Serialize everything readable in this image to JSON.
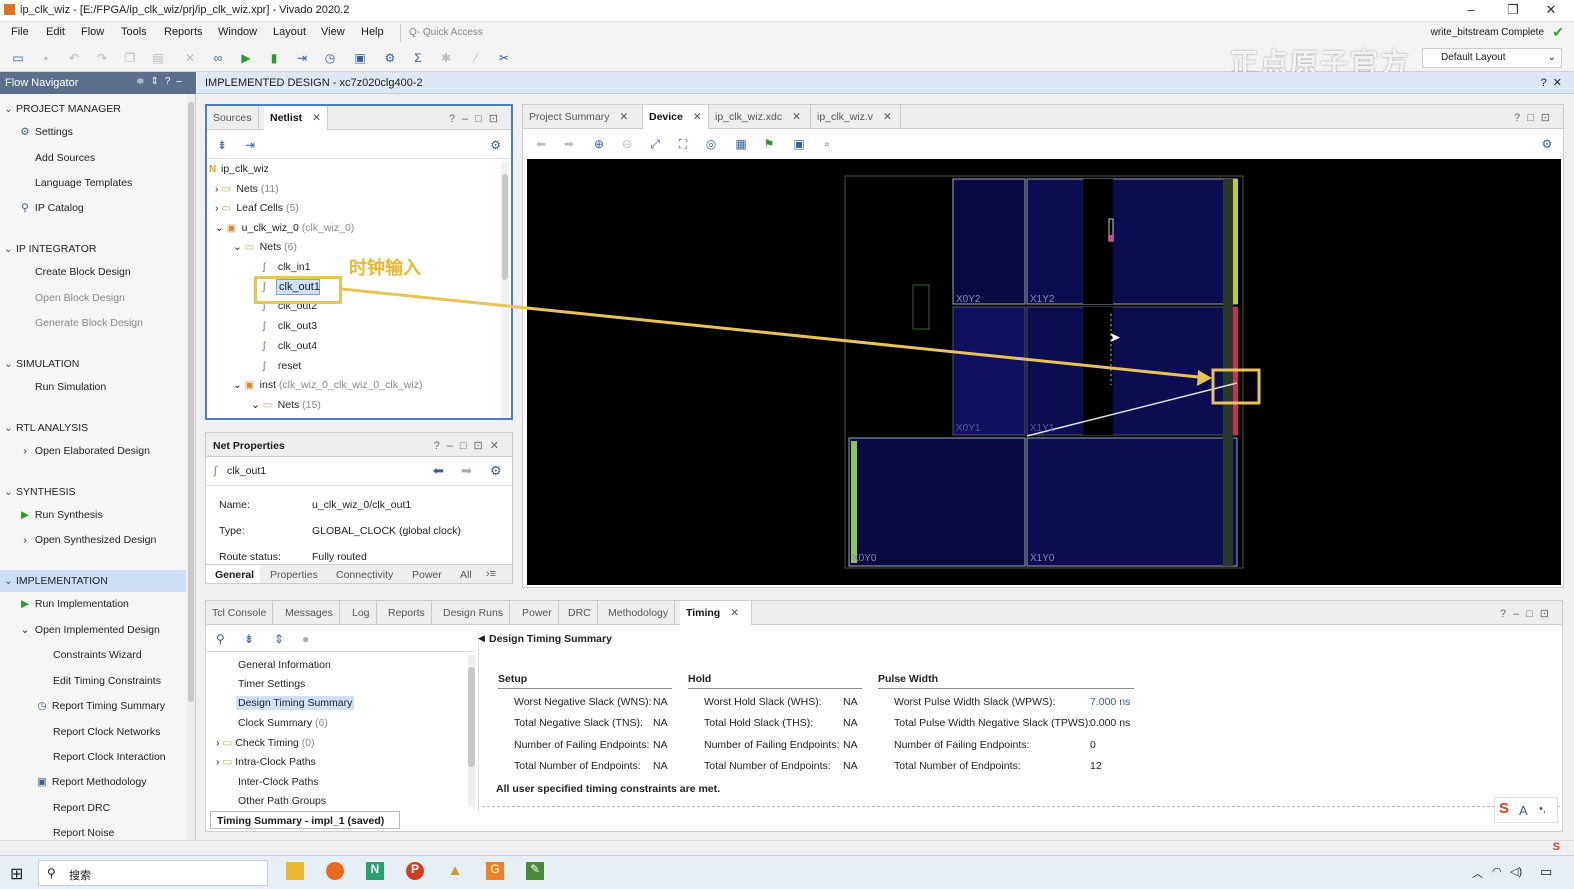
{
  "window": {
    "title": "ip_clk_wiz - [E:/FPGA/ip_clk_wiz/prj/ip_clk_wiz.xpr] - Vivado 2020.2"
  },
  "menu": [
    "File",
    "Edit",
    "Flow",
    "Tools",
    "Reports",
    "Window",
    "Layout",
    "View",
    "Help"
  ],
  "quick_access_placeholder": "Q- Quick Access",
  "write_status": "write_bitstream Complete",
  "layout_select": "Default Layout",
  "watermark": "正点原子官方",
  "flow_navigator": {
    "title": "Flow Navigator",
    "sections": [
      {
        "label": "PROJECT MANAGER",
        "items": [
          "Settings",
          "Add Sources",
          "Language Templates",
          "IP Catalog"
        ]
      },
      {
        "label": "IP INTEGRATOR",
        "items": [
          "Create Block Design",
          "Open Block Design",
          "Generate Block Design"
        ]
      },
      {
        "label": "SIMULATION",
        "items": [
          "Run Simulation"
        ]
      },
      {
        "label": "RTL ANALYSIS",
        "items": [
          "Open Elaborated Design"
        ]
      },
      {
        "label": "SYNTHESIS",
        "items": [
          "Run Synthesis",
          "Open Synthesized Design"
        ]
      },
      {
        "label": "IMPLEMENTATION",
        "items": [
          "Run Implementation",
          "Open Implemented Design",
          "Constraints Wizard",
          "Edit Timing Constraints",
          "Report Timing Summary",
          "Report Clock Networks",
          "Report Clock Interaction",
          "Report Methodology",
          "Report DRC",
          "Report Noise"
        ]
      }
    ]
  },
  "impl_title": "IMPLEMENTED DESIGN - xc7z020clg400-2",
  "netlist": {
    "tabs": [
      "Sources",
      "Netlist"
    ],
    "tree": {
      "root": "ip_clk_wiz",
      "nets_label": "Nets",
      "nets_count": "(11)",
      "leaf_label": "Leaf Cells",
      "leaf_count": "(5)",
      "inst_label": "u_clk_wiz_0",
      "inst_type": "(clk_wiz_0)",
      "sub_nets_label": "Nets",
      "sub_nets_count": "(6)",
      "nets": [
        "clk_in1",
        "clk_out1",
        "clk_out2",
        "clk_out3",
        "clk_out4",
        "reset"
      ],
      "inst2_label": "inst",
      "inst2_type": "(clk_wiz_0_clk_wiz_0_clk_wiz)",
      "sub2_nets_label": "Nets",
      "sub2_nets_count": "(15)"
    }
  },
  "annotation": "时钟输入",
  "net_properties": {
    "title": "Net Properties",
    "net": "clk_out1",
    "rows": [
      {
        "k": "Name:",
        "v": "u_clk_wiz_0/clk_out1"
      },
      {
        "k": "Type:",
        "v": "GLOBAL_CLOCK (global clock)"
      },
      {
        "k": "Route status:",
        "v": "Fully routed"
      }
    ],
    "tabs": [
      "General",
      "Properties",
      "Connectivity",
      "Power",
      "All"
    ]
  },
  "device": {
    "tabs": [
      "Project Summary",
      "Device",
      "ip_clk_wiz.xdc",
      "ip_clk_wiz.v"
    ],
    "regions": [
      "X0Y2",
      "X1Y2",
      "X0Y1",
      "X1Y1",
      "X0Y0",
      "X1Y0"
    ]
  },
  "bottom": {
    "tabs": [
      "Tcl Console",
      "Messages",
      "Log",
      "Reports",
      "Design Runs",
      "Power",
      "DRC",
      "Methodology",
      "Timing"
    ],
    "tree": [
      "General Information",
      "Timer Settings",
      "Design Timing Summary",
      "Clock Summary",
      "Check Timing",
      "Intra-Clock Paths",
      "Inter-Clock Paths",
      "Other Path Groups"
    ],
    "clock_summary_count": "(6)",
    "check_timing_count": "(0)",
    "heading": "Design Timing Summary",
    "setup": {
      "title": "Setup",
      "rows": [
        [
          "Worst Negative Slack (WNS):",
          "NA"
        ],
        [
          "Total Negative Slack (TNS):",
          "NA"
        ],
        [
          "Number of Failing Endpoints:",
          "NA"
        ],
        [
          "Total Number of Endpoints:",
          "NA"
        ]
      ]
    },
    "hold": {
      "title": "Hold",
      "rows": [
        [
          "Worst Hold Slack (WHS):",
          "NA"
        ],
        [
          "Total Hold Slack (THS):",
          "NA"
        ],
        [
          "Number of Failing Endpoints:",
          "NA"
        ],
        [
          "Total Number of Endpoints:",
          "NA"
        ]
      ]
    },
    "pulse": {
      "title": "Pulse Width",
      "rows": [
        [
          "Worst Pulse Width Slack (WPWS):",
          "7.000 ns"
        ],
        [
          "Total Pulse Width Negative Slack (TPWS):",
          "0.000 ns"
        ],
        [
          "Number of Failing Endpoints:",
          "0"
        ],
        [
          "Total Number of Endpoints:",
          "12"
        ]
      ]
    },
    "met": "All user specified timing constraints are met.",
    "footer_tab": "Timing Summary - impl_1 (saved)"
  },
  "taskbar": {
    "search": "搜索"
  }
}
